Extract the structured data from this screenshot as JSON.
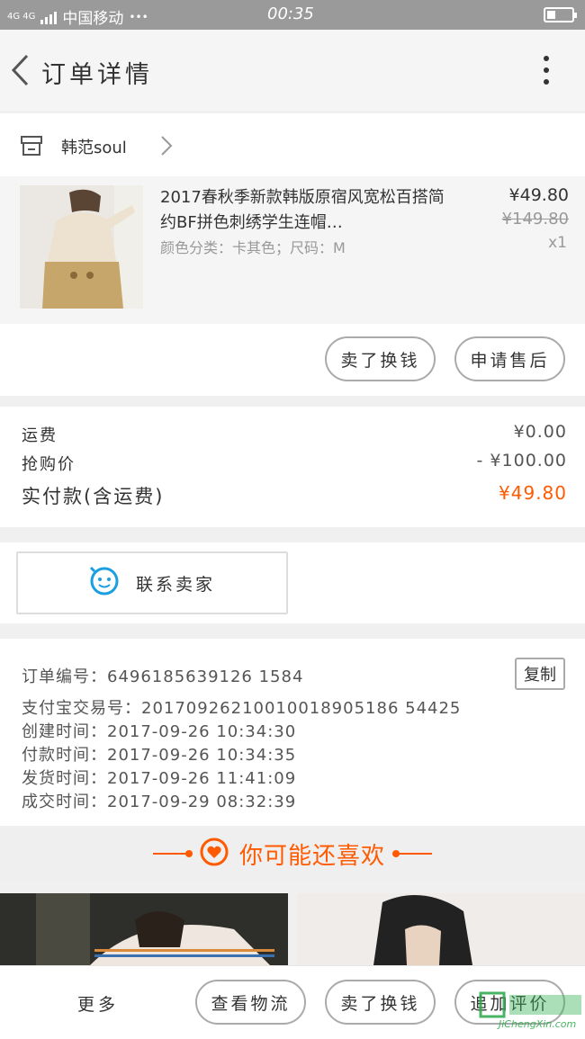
{
  "status_bar": {
    "network": "4G 4G",
    "carrier": "中国移动",
    "dots": "•••",
    "time": "00:35"
  },
  "nav": {
    "title": "订单详情"
  },
  "shop": {
    "name": "韩范soul"
  },
  "product": {
    "title": "2017春秋季新款韩版原宿风宽松百搭简约BF拼色刺绣学生连帽…",
    "spec": "颜色分类：卡其色；尺码：M",
    "price": "¥49.80",
    "original_price": "¥149.80",
    "quantity": "x1",
    "actions": [
      "卖了换钱",
      "申请售后"
    ]
  },
  "costs": {
    "shipping_label": "运费",
    "shipping_value": "¥0.00",
    "discount_label": "抢购价",
    "discount_value": "- ¥100.00",
    "total_label": "实付款(含运费)",
    "total_value": "¥49.80",
    "accent_color": "#ff5a00"
  },
  "contact": {
    "label": "联系卖家"
  },
  "order_info": {
    "order_no": "订单编号：6496185639126 1584",
    "copy_label": "复制",
    "alipay_no": "支付宝交易号：20170926210010018905186 54425",
    "created": "创建时间：2017-09-26 10:34:30",
    "paid": "付款时间：2017-09-26 10:34:35",
    "shipped": "发货时间：2017-09-26 11:41:09",
    "completed": "成交时间：2017-09-29 08:32:39"
  },
  "recommend": {
    "title": "你可能还喜欢"
  },
  "bottom_bar": {
    "more": "更多",
    "buttons": [
      "查看物流",
      "卖了换钱",
      "追加评价"
    ]
  },
  "watermark": {
    "text": "JiChengXin.com"
  }
}
